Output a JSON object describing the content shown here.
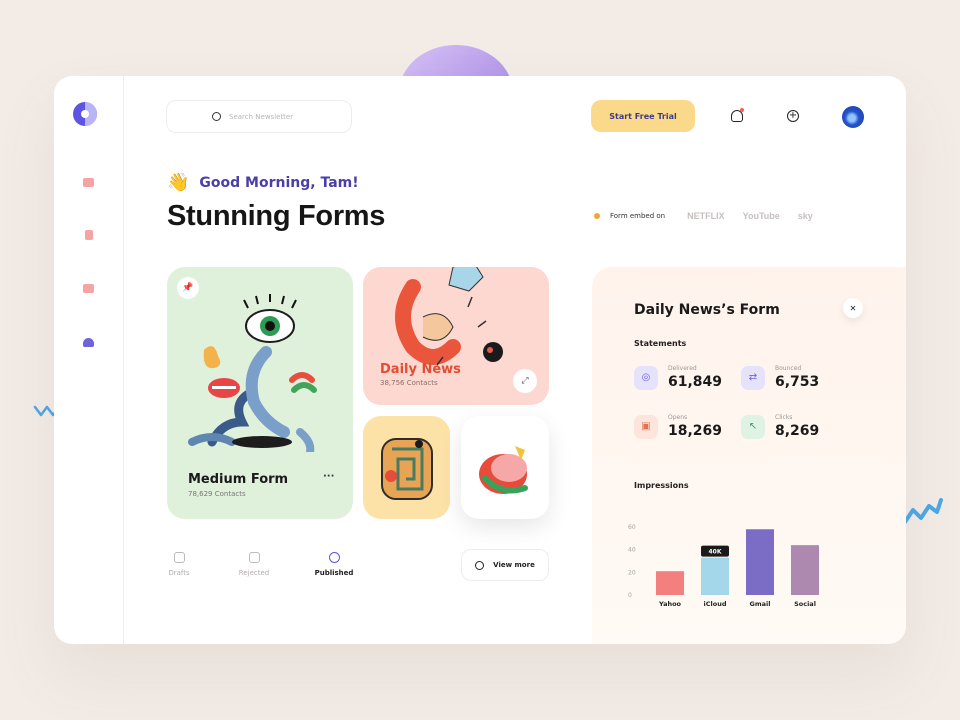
{
  "search": {
    "placeholder": "Search Newsletter"
  },
  "header": {
    "trial_label": "Start Free Trial"
  },
  "greeting": {
    "emoji": "👋",
    "text": "Good Morning, Tam!"
  },
  "page_title": "Stunning Forms",
  "embed": {
    "label": "Form embed on",
    "brands": [
      "NETFLIX",
      "YouTube",
      "sky"
    ]
  },
  "cards": {
    "medium": {
      "title": "Medium Form",
      "contacts": "78,629 Contacts",
      "more": "···"
    },
    "news": {
      "title": "Daily News",
      "contacts": "38,756 Contacts"
    }
  },
  "tabs": [
    {
      "label": "Drafts",
      "active": false
    },
    {
      "label": "Rejected",
      "active": false
    },
    {
      "label": "Published",
      "active": true
    }
  ],
  "view_more": "View more",
  "panel": {
    "title": "Daily News’s Form",
    "statements_label": "Statements",
    "stats": [
      {
        "label": "Delivered",
        "value": "61,849",
        "color": "#e6e2fb"
      },
      {
        "label": "Bounced",
        "value": "6,753",
        "color": "#e6e2fb"
      },
      {
        "label": "Opens",
        "value": "18,269",
        "color": "#fde4dc"
      },
      {
        "label": "Clicks",
        "value": "8,269",
        "color": "#def3e4"
      }
    ],
    "impressions_label": "Impressions"
  },
  "chart_data": {
    "type": "bar",
    "categories": [
      "Yahoo",
      "iCloud",
      "Gmail",
      "Social"
    ],
    "values": [
      21,
      33,
      58,
      44
    ],
    "colors": [
      "#f47f7f",
      "#a4d7ea",
      "#7b6cc6",
      "#ad89b0"
    ],
    "yticks": [
      "0",
      "20",
      "40",
      "60"
    ],
    "ylim": [
      0,
      60
    ],
    "highlight": {
      "category": "iCloud",
      "label": "40K"
    },
    "grid": false
  }
}
